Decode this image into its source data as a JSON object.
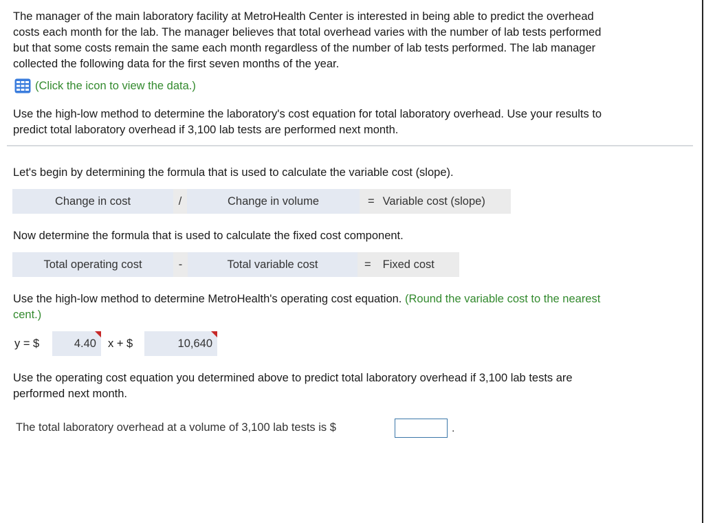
{
  "question": {
    "intro_lines": [
      "The manager of the main laboratory facility at MetroHealth Center is interested in being able to predict the overhead",
      "costs each month for the lab. The manager believes that total overhead varies with the number of lab tests performed",
      "but that some costs remain the same each month regardless of the number of lab tests performed. The lab manager",
      "collected the following data for the first seven months of the year."
    ],
    "data_link": {
      "icon": "table-grid-icon",
      "label": "(Click the icon to view the data.)"
    },
    "task_lines": [
      "Use the high-low method to determine the laboratory's cost equation for total laboratory overhead. Use your results to",
      "predict total laboratory overhead if 3,100 lab tests are performed next month."
    ]
  },
  "step1": {
    "instruction": "Let's begin by determining the formula that is used to calculate the variable cost (slope).",
    "formula": {
      "term1": "Change in cost",
      "operator": "/",
      "term2": "Change in volume",
      "equals": "=",
      "result": "Variable cost (slope)"
    }
  },
  "step2": {
    "instruction": "Now determine the formula that is used to calculate the fixed cost component.",
    "formula": {
      "term1": "Total operating cost",
      "operator": "-",
      "term2": "Total variable cost",
      "equals": "=",
      "result": "Fixed cost"
    }
  },
  "step3": {
    "instruction": "Use the high-low method to determine MetroHealth's operating cost equation.",
    "hint_line1": "(Round the variable cost to the nearest",
    "hint_line2": "cent.)",
    "equation": {
      "prefix": "y = $",
      "variable_cost": "4.40",
      "middle": "x + $",
      "fixed_cost": "10,640"
    }
  },
  "step4": {
    "instruction_lines": [
      "Use the operating cost equation you determined above to predict total laboratory overhead if 3,100 lab tests are",
      "performed next month."
    ],
    "answer_prompt": "The total laboratory overhead at a volume of 3,100 lab tests is $",
    "answer_value": "",
    "answer_suffix": "."
  }
}
